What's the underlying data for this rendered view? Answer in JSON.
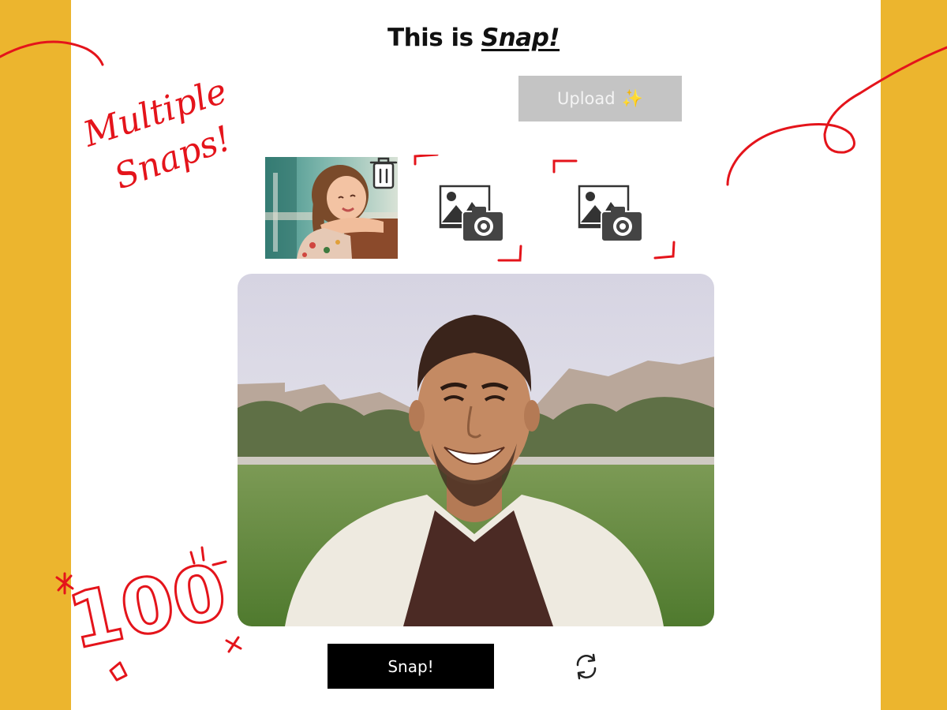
{
  "header": {
    "title_prefix": "This is ",
    "title_brand": "Snap!"
  },
  "toolbar": {
    "upload_label": "Upload",
    "upload_icon": "✨",
    "upload_state": "disabled"
  },
  "snaps": {
    "slots": [
      {
        "state": "filled",
        "description": "photo of smiling girl"
      },
      {
        "state": "empty",
        "icon": "add-photo-icon"
      },
      {
        "state": "empty",
        "icon": "add-photo-icon"
      }
    ],
    "delete_icon": "trash-icon"
  },
  "camera": {
    "feed": "live preview of smiling man outdoors"
  },
  "controls": {
    "snap_label": "Snap!",
    "switch_icon": "switch-camera-icon"
  },
  "annotations": {
    "note_1": "Multiple Snaps!",
    "note_2": "100"
  },
  "colors": {
    "background": "#ECB52E",
    "panel": "#FFFFFF",
    "accent_ink": "#E4141B",
    "snap_button": "#000000",
    "upload_disabled": "#C4C4C4"
  }
}
